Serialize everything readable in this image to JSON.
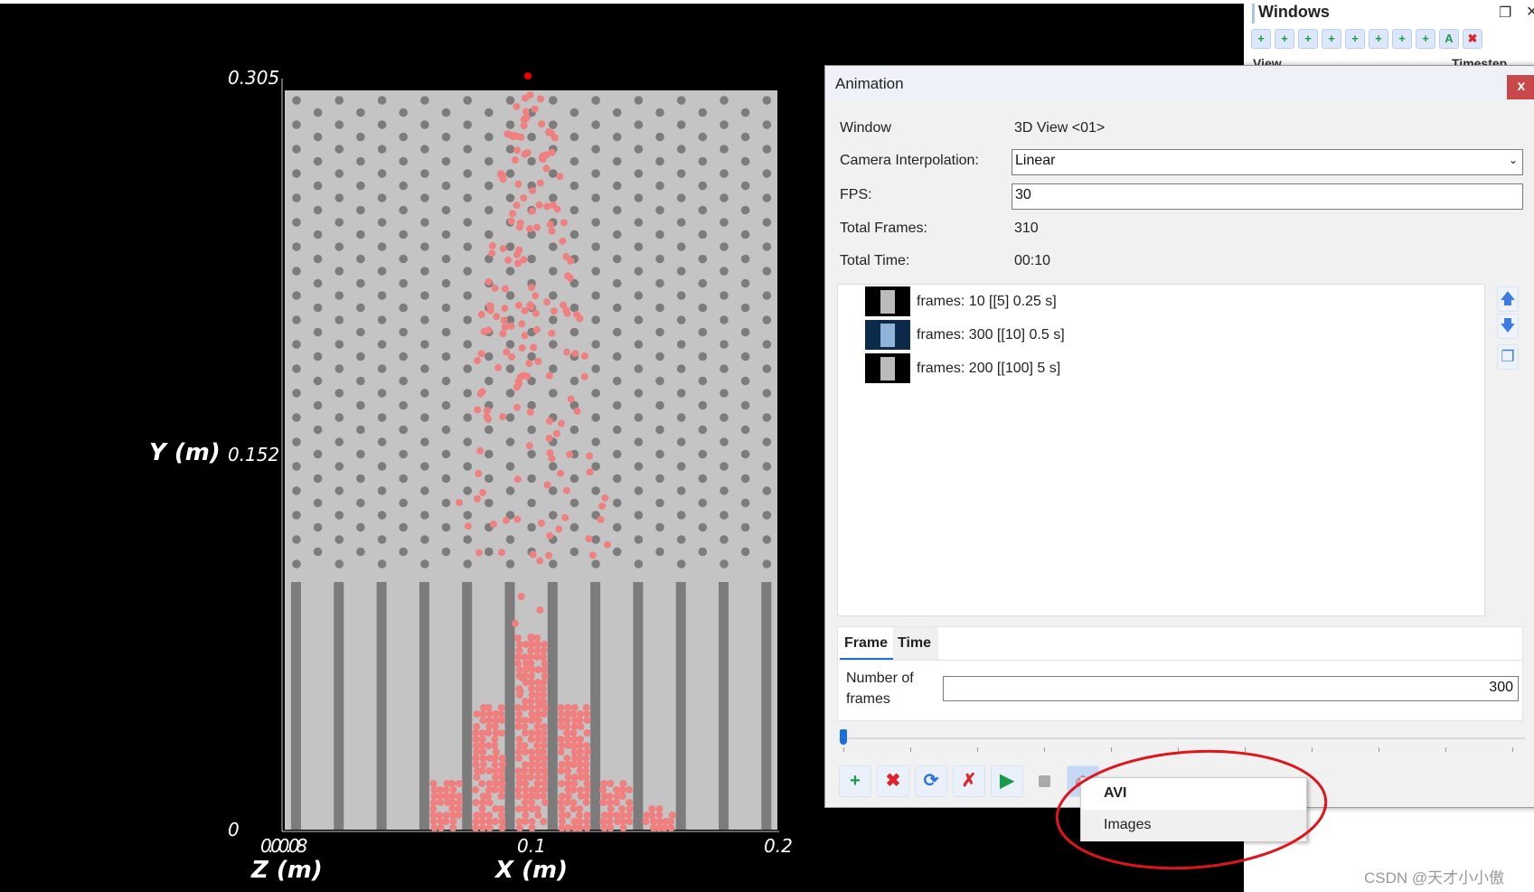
{
  "viewport": {
    "y_axis_label": "Y (m)",
    "x_axis_label": "X (m)",
    "z_axis_label": "Z (m)",
    "y_ticks": [
      "0.305",
      "0.152",
      "0"
    ],
    "x_ticks": [
      "0.1",
      "0.2"
    ],
    "z_tick": "0.00.08"
  },
  "windows_panel": {
    "title": "Windows",
    "tools": [
      "add-3d-view-icon",
      "add-histogram-icon",
      "add-bar-chart-icon",
      "add-distribution-icon",
      "add-scatter-icon",
      "add-multi-chart-icon",
      "add-table-icon",
      "add-view-icon",
      "text-icon",
      "delete-icon"
    ],
    "columns": [
      "View",
      "Timestep"
    ]
  },
  "dialog": {
    "title": "Animation",
    "close_label": "x",
    "window_label": "Window",
    "window_value": "3D View <01>",
    "camera_label": "Camera Interpolation:",
    "camera_value": "Linear",
    "fps_label": "FPS:",
    "fps_value": "30",
    "total_frames_label": "Total Frames:",
    "total_frames_value": "310",
    "total_time_label": "Total Time:",
    "total_time_value": "00:10",
    "keyframes": [
      {
        "label": "frames: 10 [[5] 0.25 s]",
        "selected": false
      },
      {
        "label": "frames: 300 [[10] 0.5 s]",
        "selected": true
      },
      {
        "label": "frames: 200 [[100] 5 s]",
        "selected": false
      }
    ],
    "tabs": [
      "Frame",
      "Time"
    ],
    "active_tab": "Frame",
    "num_frames_label": "Number of frames",
    "num_frames_value": "300",
    "slider_value": 0
  },
  "export_menu": {
    "items": [
      "AVI",
      "Images"
    ]
  },
  "watermark": "CSDN @天才小小傲",
  "colors": {
    "accent": "#3b7de0",
    "close": "#c9494b",
    "particle": "#f08080",
    "annotation": "#e0151b"
  }
}
